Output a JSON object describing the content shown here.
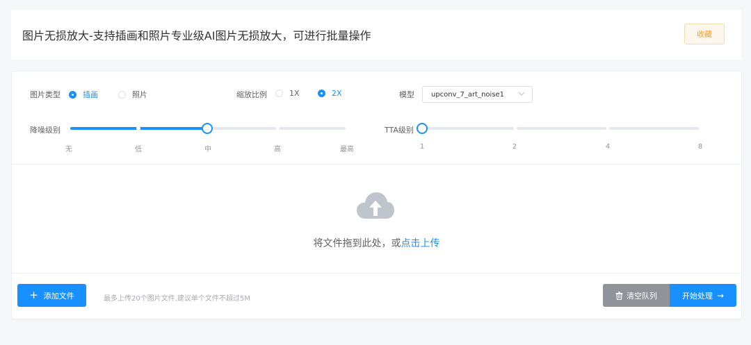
{
  "header": {
    "title": "图片无损放大-支持插画和照片专业级AI图片无损放大，可进行批量操作",
    "favorite_label": "收藏"
  },
  "options": {
    "image_type": {
      "label": "图片类型",
      "options": [
        "插画",
        "照片"
      ],
      "selected": "插画"
    },
    "scale": {
      "label": "缩放比例",
      "options": [
        "1X",
        "2X"
      ],
      "selected": "2X"
    },
    "model": {
      "label": "模型",
      "value": "upconv_7_art_noise1"
    }
  },
  "sliders": {
    "denoise": {
      "label": "降噪级别",
      "ticks": [
        "无",
        "低",
        "中",
        "高",
        "最高"
      ],
      "selected_index": 2
    },
    "tta": {
      "label": "TTA级别",
      "ticks": [
        "1",
        "2",
        "4",
        "8"
      ],
      "selected_index": 0
    }
  },
  "dropzone": {
    "text": "将文件拖到此处，或",
    "link": "点击上传"
  },
  "footer": {
    "add_files_label": "添加文件",
    "hint": "最多上传20个图片文件,建议单个文件不超过5M",
    "clear_queue_label": "清空队列",
    "start_label": "开始处理"
  },
  "colors": {
    "primary": "#1890ff",
    "gray_button": "#909399",
    "favorite_text": "#e6a23c"
  }
}
